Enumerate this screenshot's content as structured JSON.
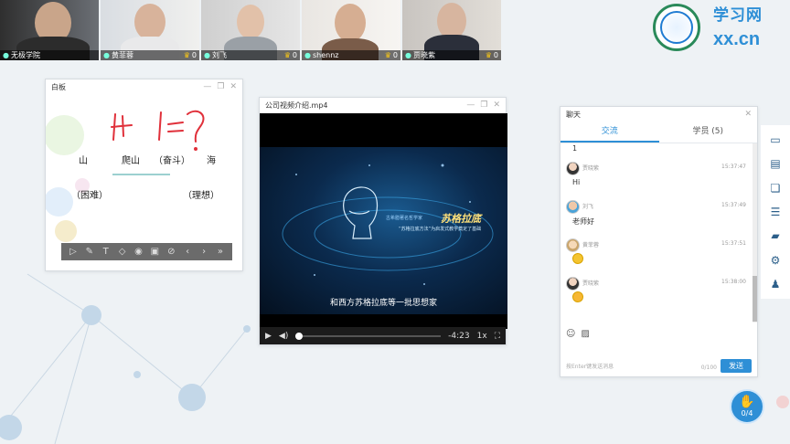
{
  "brand": {
    "logo_name": "学习网",
    "logo_domain": "xx.cn",
    "seal_text": "学习网"
  },
  "participants": [
    {
      "name": "无极学院",
      "score": ""
    },
    {
      "name": "黄菲蓉",
      "score": "0"
    },
    {
      "name": "刘飞",
      "score": "0"
    },
    {
      "name": "shennz",
      "score": "0"
    },
    {
      "name": "贾晓紫",
      "score": "0"
    }
  ],
  "whiteboard": {
    "title": "白板",
    "handwriting": "I+I=?",
    "words": [
      "山",
      "爬山",
      "（奋斗）",
      "海",
      "（困难）",
      "（理想）"
    ]
  },
  "player": {
    "title": "公司视频介绍.mp4",
    "overlay_title": "苏格拉底",
    "overlay_small": "古希腊著名哲学家",
    "overlay_line": "“苏格拉底方法”为启发式教学奠定了基础",
    "subtitle": "和西方苏格拉底等一批思想家",
    "time": "-4:23",
    "speed": "1x"
  },
  "chat": {
    "title": "聊天",
    "tabs": [
      "交流",
      "学员 (5)"
    ],
    "first_line": "1",
    "messages": [
      {
        "name": "贾晓紫",
        "time": "15:37:47",
        "text": "Hi",
        "emoji": false
      },
      {
        "name": "刘飞",
        "time": "15:37:49",
        "text": "老师好",
        "emoji": false
      },
      {
        "name": "黄菲蓉",
        "time": "15:37:51",
        "text": "",
        "emoji": true
      },
      {
        "name": "贾晓紫",
        "time": "15:38:00",
        "text": "",
        "emoji": true
      }
    ],
    "hint": "按Enter键发送消息",
    "counter": "0/100",
    "send_label": "发送"
  },
  "hand_raise": {
    "count": "0/4"
  },
  "colors": {
    "accent": "#2e8fd6",
    "marker": "#e0303a",
    "whiteboard_bar": "#6b6b6b"
  }
}
